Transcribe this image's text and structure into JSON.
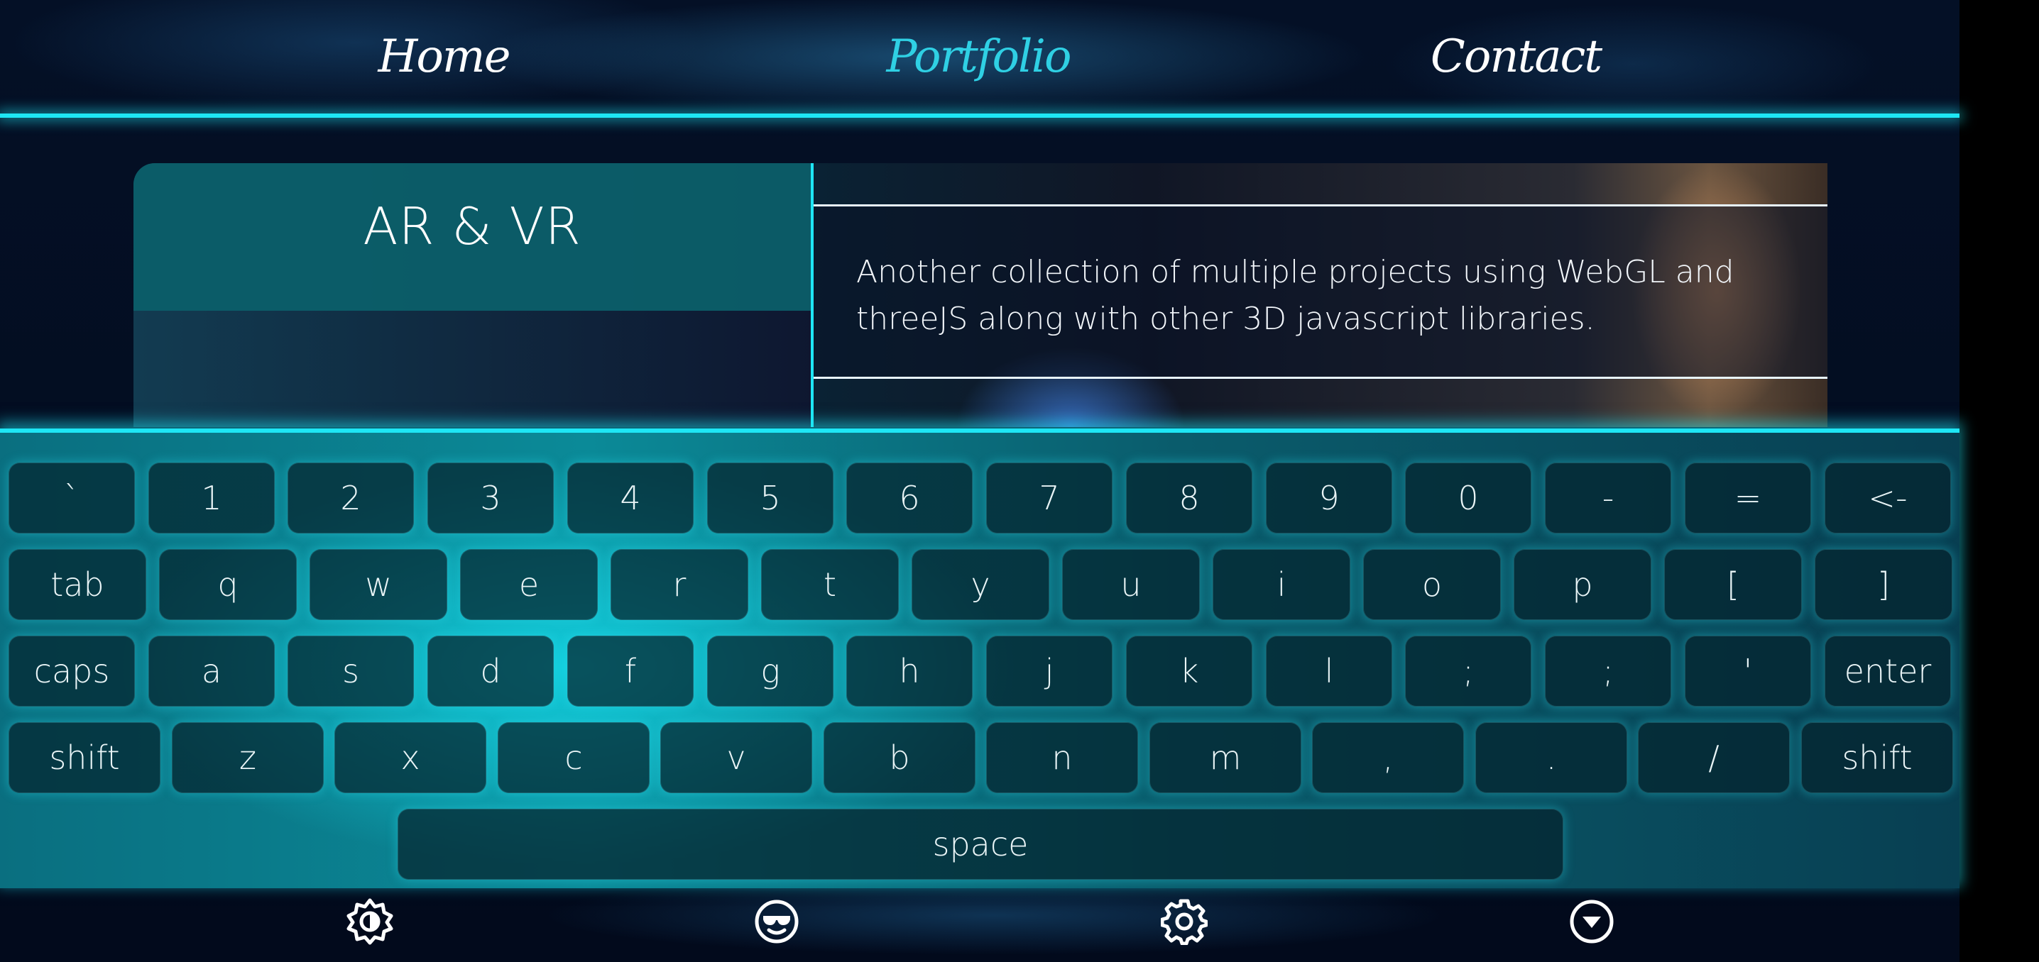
{
  "nav": {
    "links": [
      {
        "label": "Home",
        "active": false
      },
      {
        "label": "Portfolio",
        "active": true
      },
      {
        "label": "Contact",
        "active": false
      }
    ]
  },
  "card": {
    "title": "AR & VR",
    "description": "Another collection of multiple projects using WebGL and threeJS along with other 3D javascript libraries."
  },
  "keyboard": {
    "row1": [
      "`",
      "1",
      "2",
      "3",
      "4",
      "5",
      "6",
      "7",
      "8",
      "9",
      "0",
      "-",
      "=",
      "<-"
    ],
    "row2": [
      "tab",
      "q",
      "w",
      "e",
      "r",
      "t",
      "y",
      "u",
      "i",
      "o",
      "p",
      "[",
      "]"
    ],
    "row3": [
      "caps",
      "a",
      "s",
      "d",
      "f",
      "g",
      "h",
      "j",
      "k",
      "l",
      ";",
      ";",
      "'",
      "enter"
    ],
    "row4": [
      "shift",
      "z",
      "x",
      "c",
      "v",
      "b",
      "n",
      "m",
      ",",
      ".",
      "/",
      "shift"
    ],
    "row5": [
      "space"
    ]
  },
  "toolbar": {
    "icons": [
      "brightness-icon",
      "sunglasses-emoji-icon",
      "settings-gear-icon",
      "collapse-keyboard-icon"
    ]
  },
  "colors": {
    "accent": "#1ee6f5",
    "active_nav": "#2fd0e4",
    "key_bg": "#04222c"
  }
}
